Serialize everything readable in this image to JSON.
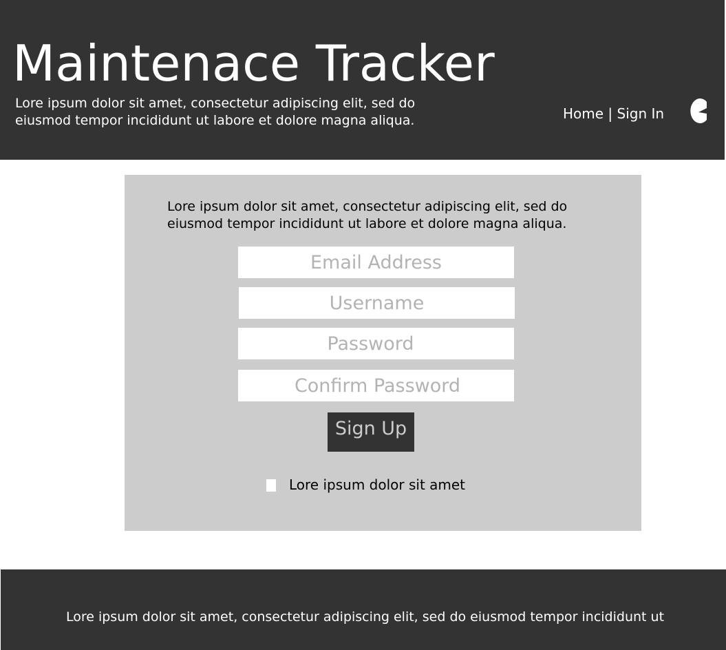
{
  "header": {
    "title": "Maintenace Tracker",
    "tagline": "Lore ipsum dolor sit amet, consectetur adipiscing elit, sed do eiusmod tempor incididunt ut labore et dolore magna aliqua.",
    "nav": {
      "home": "Home",
      "separator": " | ",
      "sign_in": "Sign In"
    },
    "logo_icon": "pacman-logo-icon"
  },
  "form": {
    "intro": "Lore ipsum dolor sit amet, consectetur adipiscing elit, sed do eiusmod tempor incididunt ut labore et dolore magna aliqua.",
    "email_placeholder": "Email Address",
    "username_placeholder": "Username",
    "password_placeholder": "Password",
    "confirm_password_placeholder": "Confirm Password",
    "submit_label": "Sign Up",
    "checkbox_label": "Lore ipsum dolor sit amet"
  },
  "footer": {
    "text": "Lore ipsum dolor sit amet, consectetur adipiscing elit, sed do eiusmod tempor incididunt ut"
  },
  "colors": {
    "dark": "#333333",
    "panel": "#cccccc",
    "placeholder": "#b3b3b3",
    "white": "#ffffff"
  }
}
